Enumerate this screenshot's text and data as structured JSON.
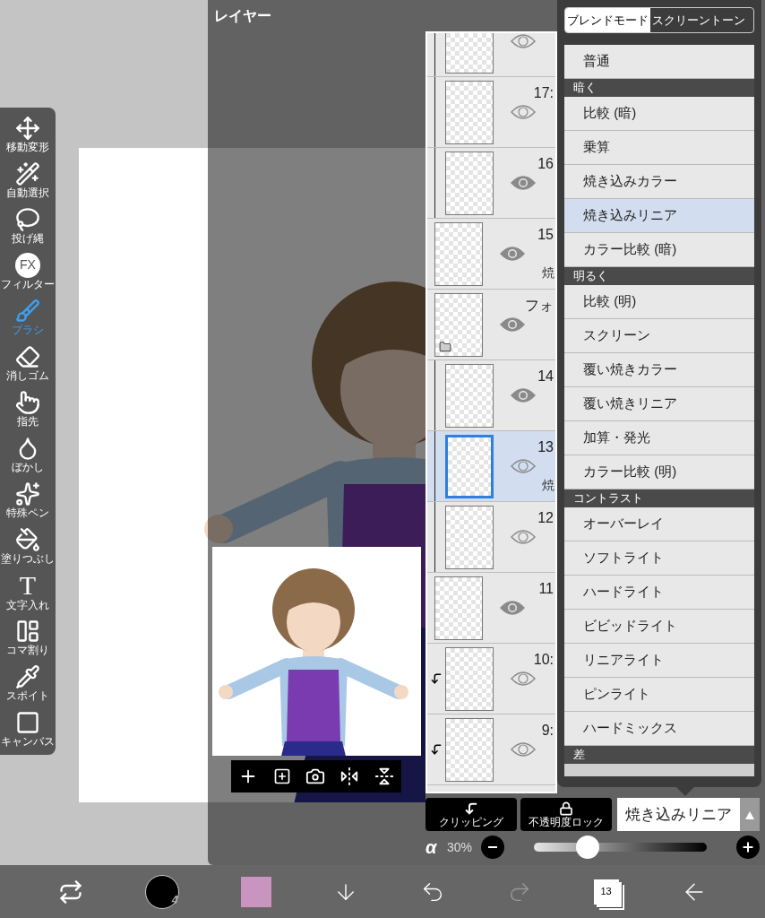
{
  "tools": [
    {
      "label": "移動変形",
      "kind": "move",
      "selected": false
    },
    {
      "label": "自動選択",
      "kind": "wand",
      "selected": false
    },
    {
      "label": "投げ縄",
      "kind": "lasso",
      "selected": false
    },
    {
      "label": "フィルター",
      "kind": "filter",
      "glyph": "FX",
      "selected": false
    },
    {
      "label": "ブラシ",
      "kind": "brush",
      "selected": true
    },
    {
      "label": "消しゴム",
      "kind": "eraser",
      "selected": false
    },
    {
      "label": "指先",
      "kind": "smudge",
      "selected": false
    },
    {
      "label": "ぼかし",
      "kind": "blur",
      "selected": false
    },
    {
      "label": "特殊ペン",
      "kind": "special",
      "selected": false
    },
    {
      "label": "塗りつぶし",
      "kind": "fill",
      "selected": false
    },
    {
      "label": "文字入れ",
      "kind": "text",
      "glyph": "T",
      "selected": false
    },
    {
      "label": "コマ割り",
      "kind": "frame",
      "selected": false
    },
    {
      "label": "スポイト",
      "kind": "eyedropper",
      "selected": false
    },
    {
      "label": "キャンバス",
      "kind": "canvas",
      "selected": false
    }
  ],
  "layer_panel": {
    "title": "レイヤー",
    "layers": [
      {
        "kind": "group",
        "children": [
          {
            "kind": "layer",
            "visible": false,
            "selected": false,
            "clipping": false
          },
          {
            "kind": "layer",
            "name": "17:",
            "visible": false,
            "selected": false,
            "clipping": false
          },
          {
            "kind": "layer",
            "name": "16",
            "visible": true,
            "selected": false,
            "clipping": false
          }
        ]
      },
      {
        "kind": "layer",
        "name": "15",
        "mode": "焼",
        "visible": true,
        "selected": false,
        "clipping": false
      },
      {
        "kind": "folder",
        "name": "フォ",
        "visible": true,
        "selected": false,
        "children": [
          {
            "kind": "layer",
            "name": "14",
            "visible": true,
            "selected": false,
            "clipping": false
          },
          {
            "kind": "layer",
            "name": "13",
            "mode": "焼",
            "visible": false,
            "selected": true,
            "clipping": false
          },
          {
            "kind": "layer",
            "name": "12",
            "visible": false,
            "selected": false,
            "clipping": false
          }
        ]
      },
      {
        "kind": "layer",
        "name": "11",
        "visible": true,
        "selected": false,
        "clipping": false
      },
      {
        "kind": "layer",
        "name": "10:",
        "visible": false,
        "selected": false,
        "clipping": true
      },
      {
        "kind": "layer",
        "name": "9:",
        "visible": false,
        "selected": false,
        "clipping": true
      }
    ],
    "clipping_button": "クリッピング",
    "alpha_lock_button": "不透明度ロック",
    "blend_select": "焼き込みリニア",
    "opacity": {
      "symbol": "α",
      "reading": "30%",
      "level": 0.31
    }
  },
  "blend_menu": {
    "tabs": [
      {
        "label": "ブレンドモード",
        "selected": true
      },
      {
        "label": "スクリーントーン",
        "selected": false
      }
    ],
    "items": [
      {
        "kind": "item",
        "label": "普通",
        "selected": false
      },
      {
        "kind": "header",
        "label": "暗く"
      },
      {
        "kind": "item",
        "label": "比較 (暗)",
        "selected": false
      },
      {
        "kind": "item",
        "label": "乗算",
        "selected": false
      },
      {
        "kind": "item",
        "label": "焼き込みカラー",
        "selected": false
      },
      {
        "kind": "item",
        "label": "焼き込みリニア",
        "selected": true
      },
      {
        "kind": "item",
        "label": "カラー比較 (暗)",
        "selected": false
      },
      {
        "kind": "header",
        "label": "明るく"
      },
      {
        "kind": "item",
        "label": "比較 (明)",
        "selected": false
      },
      {
        "kind": "item",
        "label": "スクリーン",
        "selected": false
      },
      {
        "kind": "item",
        "label": "覆い焼きカラー",
        "selected": false
      },
      {
        "kind": "item",
        "label": "覆い焼きリニア",
        "selected": false
      },
      {
        "kind": "item",
        "label": "加算・発光",
        "selected": false
      },
      {
        "kind": "item",
        "label": "カラー比較 (明)",
        "selected": false
      },
      {
        "kind": "header",
        "label": "コントラスト"
      },
      {
        "kind": "item",
        "label": "オーバーレイ",
        "selected": false
      },
      {
        "kind": "item",
        "label": "ソフトライト",
        "selected": false
      },
      {
        "kind": "item",
        "label": "ハードライト",
        "selected": false
      },
      {
        "kind": "item",
        "label": "ビビッドライト",
        "selected": false
      },
      {
        "kind": "item",
        "label": "リニアライト",
        "selected": false
      },
      {
        "kind": "item",
        "label": "ピンライト",
        "selected": false
      },
      {
        "kind": "item",
        "label": "ハードミックス",
        "selected": false
      },
      {
        "kind": "header",
        "label": "差"
      }
    ]
  },
  "bottom_bar": {
    "brush": {
      "size": "4",
      "color": "#000000"
    },
    "secondary": {
      "color": "#c994c0"
    },
    "layer_count": "13"
  }
}
